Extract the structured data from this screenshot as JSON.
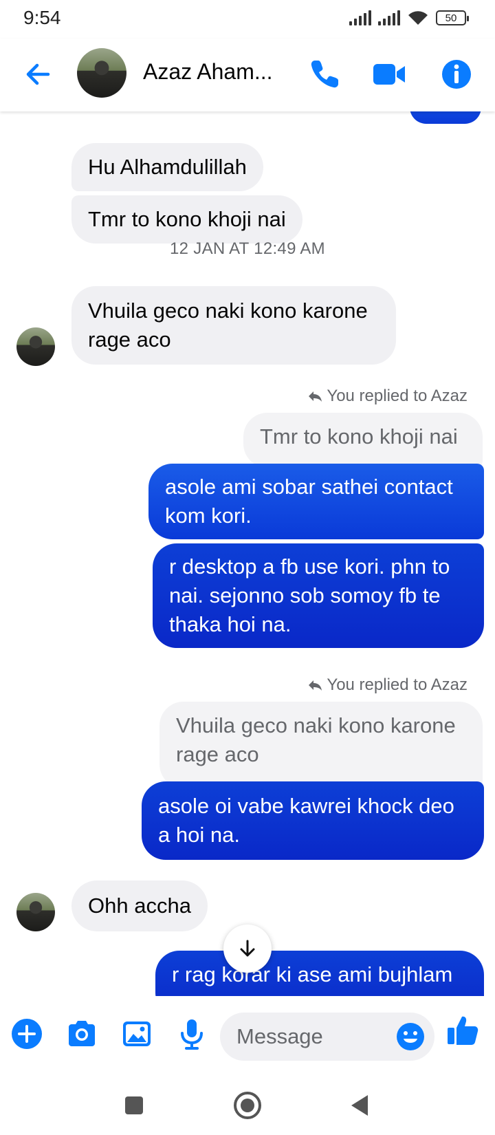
{
  "status_bar": {
    "time": "9:54",
    "battery": "50"
  },
  "header": {
    "contact_name": "Azaz Aham..."
  },
  "chat": {
    "messages": [
      {
        "text": "Hu Alhamdulillah"
      },
      {
        "text": "Tmr to kono khoji nai"
      },
      {
        "timestamp": "12 JAN AT 12:49 AM"
      },
      {
        "text": "Vhuila geco naki kono karone rage aco"
      },
      {
        "reply_note": "You replied to Azaz",
        "quoted": "Tmr to kono khoji nai"
      },
      {
        "text": "asole ami sobar sathei contact kom kori."
      },
      {
        "text": "r desktop a fb use kori. phn to nai. sejonno sob somoy fb te thaka hoi na."
      },
      {
        "reply_note": "You replied to Azaz",
        "quoted": "Vhuila geco naki kono karone rage aco"
      },
      {
        "text": "asole oi vabe kawrei khock deo a hoi na."
      },
      {
        "text": "Ohh accha"
      },
      {
        "text": "r rag korar ki ase ami bujhlam"
      }
    ]
  },
  "composer": {
    "placeholder": "Message"
  },
  "colors": {
    "accent": "#0a7cff",
    "outgoing_bubble": "#0a3ad8",
    "incoming_bubble": "#f0f0f3"
  },
  "icons": [
    "back-arrow-icon",
    "phone-icon",
    "video-camera-icon",
    "info-icon",
    "plus-icon",
    "camera-icon",
    "gallery-icon",
    "microphone-icon",
    "emoji-icon",
    "thumbs-up-icon",
    "reply-icon",
    "arrow-down-icon"
  ]
}
